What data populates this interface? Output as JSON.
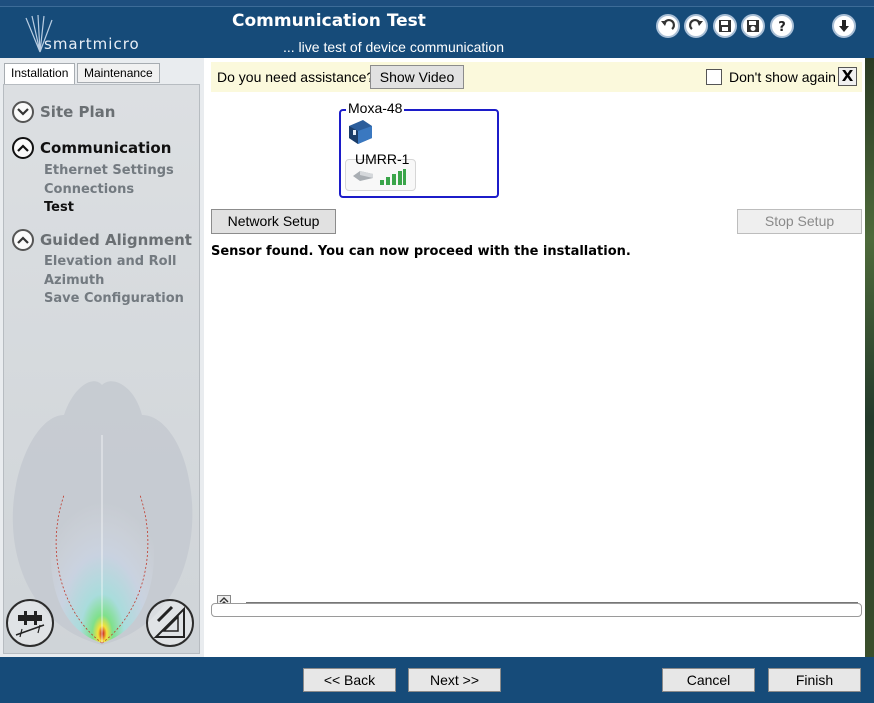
{
  "header": {
    "logo_text": "smartmicro",
    "title": "Communication Test",
    "subtitle": "... live test of device communication",
    "icons": [
      "undo-icon",
      "redo-icon",
      "save-icon",
      "save-as-icon",
      "help-icon",
      "download-icon"
    ]
  },
  "tabs": [
    {
      "label": "Installation",
      "active": true
    },
    {
      "label": "Maintenance",
      "active": false
    }
  ],
  "nav": {
    "sections": [
      {
        "label": "Site Plan",
        "expanded": false,
        "items": []
      },
      {
        "label": "Communication",
        "expanded": true,
        "items": [
          "Ethernet Settings",
          "Connections",
          "Test"
        ],
        "current": "Test"
      },
      {
        "label": "Guided Alignment",
        "expanded": true,
        "items": [
          "Elevation and Roll",
          "Azimuth",
          "Save Configuration"
        ]
      }
    ]
  },
  "assist": {
    "question": "Do you need assistance?",
    "show_video": "Show Video",
    "dont_show": "Don't show again",
    "close": "X",
    "dont_show_checked": false
  },
  "device": {
    "gateway_name": "Moxa-48",
    "sensor_name": "UMRR-1",
    "signal_bars": 5,
    "accent": "#1c1cc9"
  },
  "actions": {
    "network_setup": "Network Setup",
    "stop_setup": "Stop Setup"
  },
  "status_message": "Sensor found. You can now proceed with the installation.",
  "footer": {
    "back": "<<  Back",
    "next": "Next  >>",
    "cancel": "Cancel",
    "finish": "Finish"
  },
  "colors": {
    "header_bg": "#164b79",
    "assist_bg": "#fbf9dc"
  }
}
